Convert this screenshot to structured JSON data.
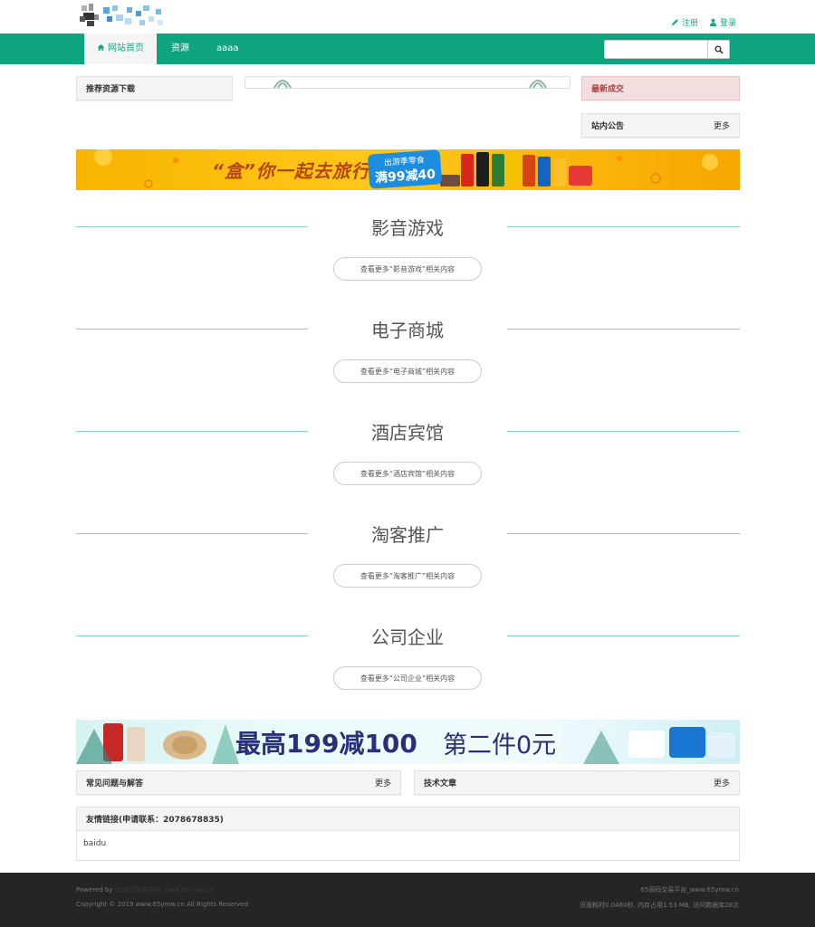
{
  "header": {
    "register_label": "注册",
    "login_label": "登录"
  },
  "nav": {
    "home_label": "网站首页",
    "items": [
      "资源",
      "aaaa"
    ],
    "search_placeholder": ""
  },
  "panels": {
    "recommend_title": "推荐资源下载",
    "latest_title": "最新成交",
    "notice_title": "站内公告",
    "notice_more": "更多"
  },
  "banner_top": {
    "slogan_a": "“盒”你一起去旅行",
    "badge_line1": "出游季零食",
    "badge_line2": "满99减40"
  },
  "sections": [
    {
      "title": "影音游戏",
      "more": "查看更多“影音游戏”相关内容"
    },
    {
      "title": "电子商城",
      "more": "查看更多“电子商城”相关内容"
    },
    {
      "title": "酒店宾馆",
      "more": "查看更多“酒店宾馆”相关内容"
    },
    {
      "title": "淘客推广",
      "more": "查看更多“淘客推广”相关内容"
    },
    {
      "title": "公司企业",
      "more": "查看更多“公司企业”相关内容"
    }
  ],
  "banner_bottom": {
    "text_bold": "最高199减100",
    "text_light": "第二件0元"
  },
  "bottom_panels": {
    "faq_title": "常见问题与解答",
    "faq_more": "更多",
    "articles_title": "技术文章",
    "articles_more": "更多"
  },
  "friend_links": {
    "title": "友情链接(申请联系：2078678835)",
    "items": [
      "baidu"
    ]
  },
  "footer": {
    "powered_prefix": "Powered by",
    "powered_link": "65源码交易平台_www.65ymw.cn",
    "copyright": "Copyright © 2019 www.65ymw.cn All Rights Reserved",
    "site_name": "65源码交易平台_www.65ymw.cn",
    "stats": "页面耗时0.0460秒, 内存占用1.53 MB, 访问数据库28次"
  },
  "colors": {
    "brand": "#0ea47f",
    "accent_text": "#1aa788",
    "footer_bg": "#252525"
  }
}
